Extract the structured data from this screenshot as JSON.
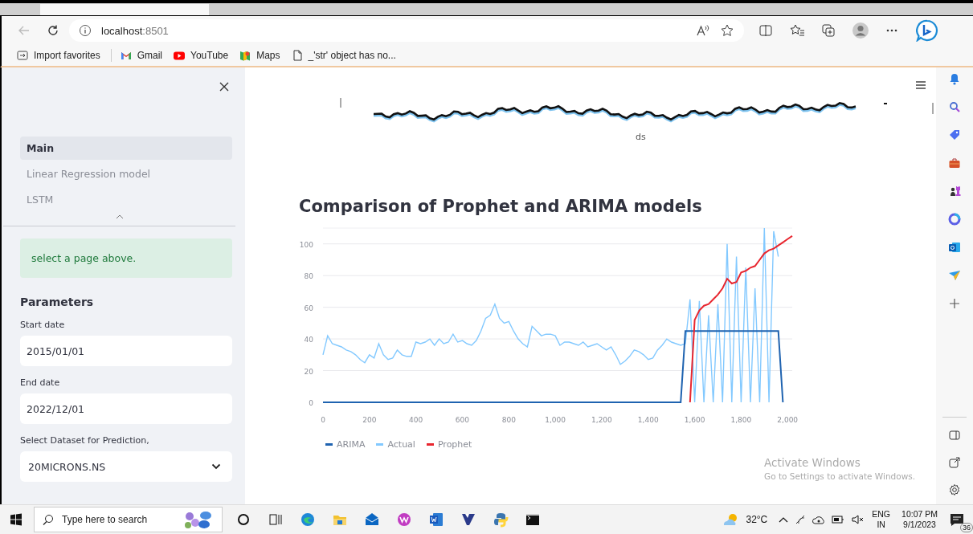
{
  "browser": {
    "address": {
      "host": "localhost",
      "port": ":8501"
    },
    "bookmarks": [
      {
        "label": "Import favorites",
        "kind": "import"
      },
      {
        "label": "Gmail",
        "kind": "gmail"
      },
      {
        "label": "YouTube",
        "kind": "youtube"
      },
      {
        "label": "Maps",
        "kind": "maps"
      },
      {
        "label": "_'str' object has no...",
        "kind": "page"
      }
    ]
  },
  "sidebar": {
    "nav": [
      {
        "label": "Main",
        "selected": true
      },
      {
        "label": "Linear Regression model",
        "selected": false
      },
      {
        "label": "LSTM",
        "selected": false
      }
    ],
    "info": "select a page above.",
    "heading": "Parameters",
    "fields": [
      {
        "label": "Start date",
        "value": "2015/01/01",
        "kind": "date"
      },
      {
        "label": "End date",
        "value": "2022/12/01",
        "kind": "date"
      },
      {
        "label": "Select Dataset for Prediction,",
        "value": "20MICRONS.NS",
        "kind": "select"
      }
    ]
  },
  "main": {
    "top_chart": {
      "xlabel": "ds"
    },
    "title": "Comparison of Prophet and ARIMA models",
    "chart_data": {
      "type": "line",
      "x": [
        0,
        20,
        40,
        60,
        80,
        100,
        120,
        140,
        160,
        180,
        200,
        220,
        240,
        260,
        280,
        300,
        320,
        340,
        360,
        380,
        400,
        420,
        440,
        460,
        480,
        500,
        520,
        540,
        560,
        580,
        600,
        620,
        640,
        660,
        680,
        700,
        720,
        740,
        760,
        780,
        800,
        820,
        840,
        860,
        880,
        900,
        920,
        940,
        960,
        980,
        1000,
        1020,
        1040,
        1060,
        1080,
        1100,
        1120,
        1140,
        1160,
        1180,
        1200,
        1220,
        1240,
        1260,
        1280,
        1300,
        1320,
        1340,
        1360,
        1380,
        1400,
        1420,
        1440,
        1460,
        1480,
        1500,
        1520,
        1540,
        1560,
        1580,
        1600,
        1620,
        1640,
        1660,
        1680,
        1700,
        1720,
        1740,
        1760,
        1780,
        1800,
        1820,
        1840,
        1860,
        1880,
        1900,
        1920,
        1940,
        1960,
        1980,
        2000,
        2020
      ],
      "series": [
        {
          "name": "ARIMA",
          "color": "#1f63b0",
          "values": [
            0,
            0,
            0,
            0,
            0,
            0,
            0,
            0,
            0,
            0,
            0,
            0,
            0,
            0,
            0,
            0,
            0,
            0,
            0,
            0,
            0,
            0,
            0,
            0,
            0,
            0,
            0,
            0,
            0,
            0,
            0,
            0,
            0,
            0,
            0,
            0,
            0,
            0,
            0,
            0,
            0,
            0,
            0,
            0,
            0,
            0,
            0,
            0,
            0,
            0,
            0,
            0,
            0,
            0,
            0,
            0,
            0,
            0,
            0,
            0,
            0,
            0,
            0,
            0,
            0,
            0,
            0,
            0,
            0,
            0,
            0,
            0,
            0,
            0,
            0,
            0,
            0,
            0,
            45,
            45,
            45,
            45,
            45,
            45,
            45,
            45,
            45,
            45,
            45,
            45,
            45,
            45,
            45,
            45,
            45,
            45,
            45,
            45,
            45,
            0,
            null,
            null
          ]
        },
        {
          "name": "Actual",
          "color": "#83c9ff",
          "values": [
            30,
            42,
            37,
            36,
            35,
            33,
            32,
            30,
            27,
            25,
            30,
            28,
            37,
            30,
            27,
            28,
            33,
            30,
            29,
            29,
            38,
            37,
            38,
            40,
            36,
            40,
            37,
            38,
            43,
            38,
            39,
            37,
            36,
            39,
            45,
            53,
            55,
            62,
            53,
            50,
            51,
            45,
            40,
            37,
            35,
            48,
            45,
            42,
            43,
            43,
            42,
            36,
            38,
            38,
            37,
            36,
            38,
            35,
            36,
            37,
            35,
            33,
            35,
            30,
            24,
            26,
            29,
            33,
            32,
            30,
            27,
            28,
            33,
            36,
            40,
            38,
            37,
            36,
            37,
            65,
            0,
            64,
            0,
            55,
            0,
            62,
            0,
            100,
            0,
            92,
            0,
            85,
            0,
            72,
            0,
            110,
            0,
            108,
            92,
            null,
            null,
            null
          ]
        },
        {
          "name": "Prophet",
          "color": "#e8262f",
          "values": [
            null,
            null,
            null,
            null,
            null,
            null,
            null,
            null,
            null,
            null,
            null,
            null,
            null,
            null,
            null,
            null,
            null,
            null,
            null,
            null,
            null,
            null,
            null,
            null,
            null,
            null,
            null,
            null,
            null,
            null,
            null,
            null,
            null,
            null,
            null,
            null,
            null,
            null,
            null,
            null,
            null,
            null,
            null,
            null,
            null,
            null,
            null,
            null,
            null,
            null,
            null,
            null,
            null,
            null,
            null,
            null,
            null,
            null,
            null,
            null,
            null,
            null,
            null,
            null,
            null,
            null,
            null,
            null,
            null,
            null,
            null,
            null,
            null,
            null,
            null,
            null,
            null,
            null,
            null,
            0,
            52,
            58,
            61,
            62,
            65,
            68,
            72,
            78,
            75,
            76,
            82,
            83,
            85,
            86,
            90,
            94,
            96,
            97,
            99,
            101,
            103,
            105
          ]
        }
      ],
      "grid": true,
      "xlim": [
        0,
        2020
      ],
      "ylim": [
        0,
        110
      ],
      "xticks": [
        0,
        200,
        400,
        600,
        800,
        {
          "value": 1000,
          "label": "1,000"
        },
        {
          "value": 1200,
          "label": "1,200"
        },
        {
          "value": 1400,
          "label": "1,400"
        },
        {
          "value": 1600,
          "label": "1,600"
        },
        {
          "value": 1800,
          "label": "1,800"
        },
        {
          "value": 2000,
          "label": "2,000"
        }
      ],
      "yticks": [
        0,
        20,
        40,
        60,
        80,
        100
      ]
    }
  },
  "os_notice": {
    "title": "Activate Windows",
    "text": "Go to Settings to activate Windows."
  },
  "taskbar": {
    "search": {
      "placeholder": "Type here to search"
    },
    "weather": "32°C",
    "language": [
      "ENG",
      "IN"
    ],
    "time": "10:07 PM",
    "date": "9/1/2023",
    "notifications": "36"
  }
}
